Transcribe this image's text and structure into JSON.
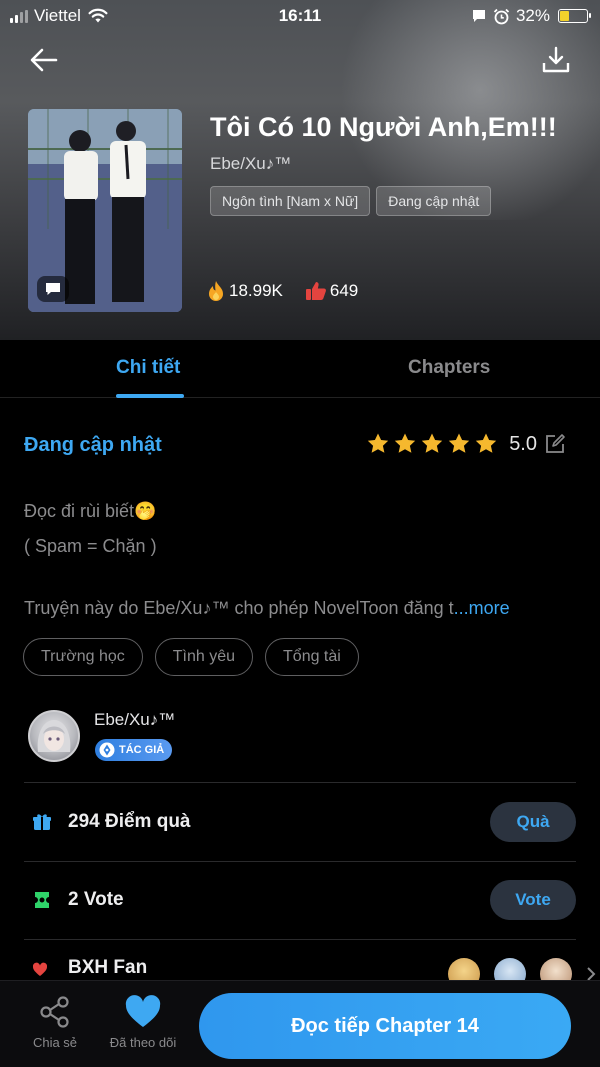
{
  "status_bar": {
    "carrier": "Viettel",
    "time": "16:11",
    "battery": "32%"
  },
  "book": {
    "title": "Tôi Có 10 Người Anh,Em!!!",
    "author": "Ebe/Xu♪™",
    "tags": [
      "Ngôn tình [Nam x Nữ]",
      "Đang cập nhật"
    ],
    "views": "18.99K",
    "likes": "649"
  },
  "tabs": {
    "detail": "Chi tiết",
    "chapters": "Chapters"
  },
  "detail": {
    "status": "Đang cập nhật",
    "rating": "5.0",
    "stars": 5,
    "description_line1": "Đọc đi rùi biết🤭",
    "description_line2": "( Spam = Chặn )",
    "permission_text": "Truyện này do Ebe/Xu♪™ cho phép NovelToon đăng t",
    "more_label": "...more",
    "genre_chips": [
      "Trường học",
      "Tình yêu",
      "Tổng tài"
    ]
  },
  "author_card": {
    "name": "Ebe/Xu♪™",
    "badge": "TÁC GIẢ"
  },
  "gifts": {
    "label": "294 Điểm quà",
    "button": "Quà"
  },
  "votes": {
    "label": "2 Vote",
    "button": "Vote"
  },
  "fan_rank": {
    "label": "BXH Fan"
  },
  "bottom_bar": {
    "share_label": "Chia sẻ",
    "follow_label": "Đã theo dõi",
    "read_button": "Đọc tiếp Chapter 14"
  },
  "colors": {
    "accent": "#3ea8f2",
    "background": "#000000",
    "star": "#f5b82e"
  }
}
